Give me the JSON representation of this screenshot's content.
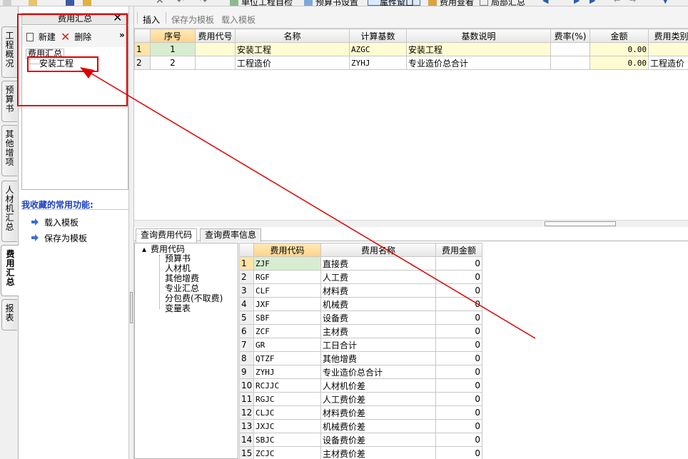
{
  "toolbar": {
    "items": [
      "单位工程自检",
      "预算书设置",
      "属性窗口",
      "费用查看",
      "局部汇总"
    ]
  },
  "vtabs": [
    "工程概况",
    "预算书",
    "其他增项",
    "人材机汇总",
    "费用汇总",
    "报表"
  ],
  "left_panel": {
    "title": "费用汇总",
    "new_label": "新建",
    "delete_label": "删除",
    "more_label": "»",
    "tree_root": "费用汇总",
    "tree_child": "安装工程",
    "fav_title": "我收藏的常用功能:",
    "fav_items": [
      "载入模板",
      "保存为模板"
    ]
  },
  "sub_toolbar": {
    "insert": "插入",
    "save_template": "保存为模板",
    "load_template": "载入模板"
  },
  "top_table": {
    "headers": [
      "",
      "序号",
      "费用代号",
      "名称",
      "计算基数",
      "基数说明",
      "费率(%)",
      "金额",
      "费用类别"
    ],
    "rows": [
      [
        "1",
        "1",
        "",
        "安装工程",
        "AZGC",
        "安装工程",
        "",
        "0.00",
        ""
      ],
      [
        "2",
        "2",
        "",
        "工程造价",
        "ZYHJ",
        "专业造价总合计",
        "",
        "0.00",
        "工程造价"
      ]
    ]
  },
  "bottom_tabs": [
    "查询费用代码",
    "查询费率信息"
  ],
  "code_tree": {
    "root": "费用代码",
    "children": [
      "预算书",
      "人材机",
      "其他增费",
      "专业汇总",
      "分包费(不取费)",
      "变量表"
    ]
  },
  "code_table": {
    "headers": [
      "",
      "费用代码",
      "费用名称",
      "费用金额"
    ],
    "rows": [
      [
        "1",
        "ZJF",
        "直接费",
        "0"
      ],
      [
        "2",
        "RGF",
        "人工费",
        "0"
      ],
      [
        "3",
        "CLF",
        "材料费",
        "0"
      ],
      [
        "4",
        "JXF",
        "机械费",
        "0"
      ],
      [
        "5",
        "SBF",
        "设备费",
        "0"
      ],
      [
        "6",
        "ZCF",
        "主材费",
        "0"
      ],
      [
        "7",
        "GR",
        "工日合计",
        "0"
      ],
      [
        "8",
        "QTZF",
        "其他增费",
        "0"
      ],
      [
        "9",
        "ZYHJ",
        "专业造价总合计",
        "0"
      ],
      [
        "10",
        "RCJJC",
        "人材机价差",
        "0"
      ],
      [
        "11",
        "RGJC",
        "人工费价差",
        "0"
      ],
      [
        "12",
        "CLJC",
        "材料费价差",
        "0"
      ],
      [
        "13",
        "JXJC",
        "机械费价差",
        "0"
      ],
      [
        "14",
        "SBJC",
        "设备费价差",
        "0"
      ],
      [
        "15",
        "ZCJC",
        "主材费价差",
        "0"
      ]
    ]
  },
  "colors": {
    "annotation": "#e00000",
    "selected_row": "#fffbd2",
    "fav_title": "#1a3fbf"
  }
}
